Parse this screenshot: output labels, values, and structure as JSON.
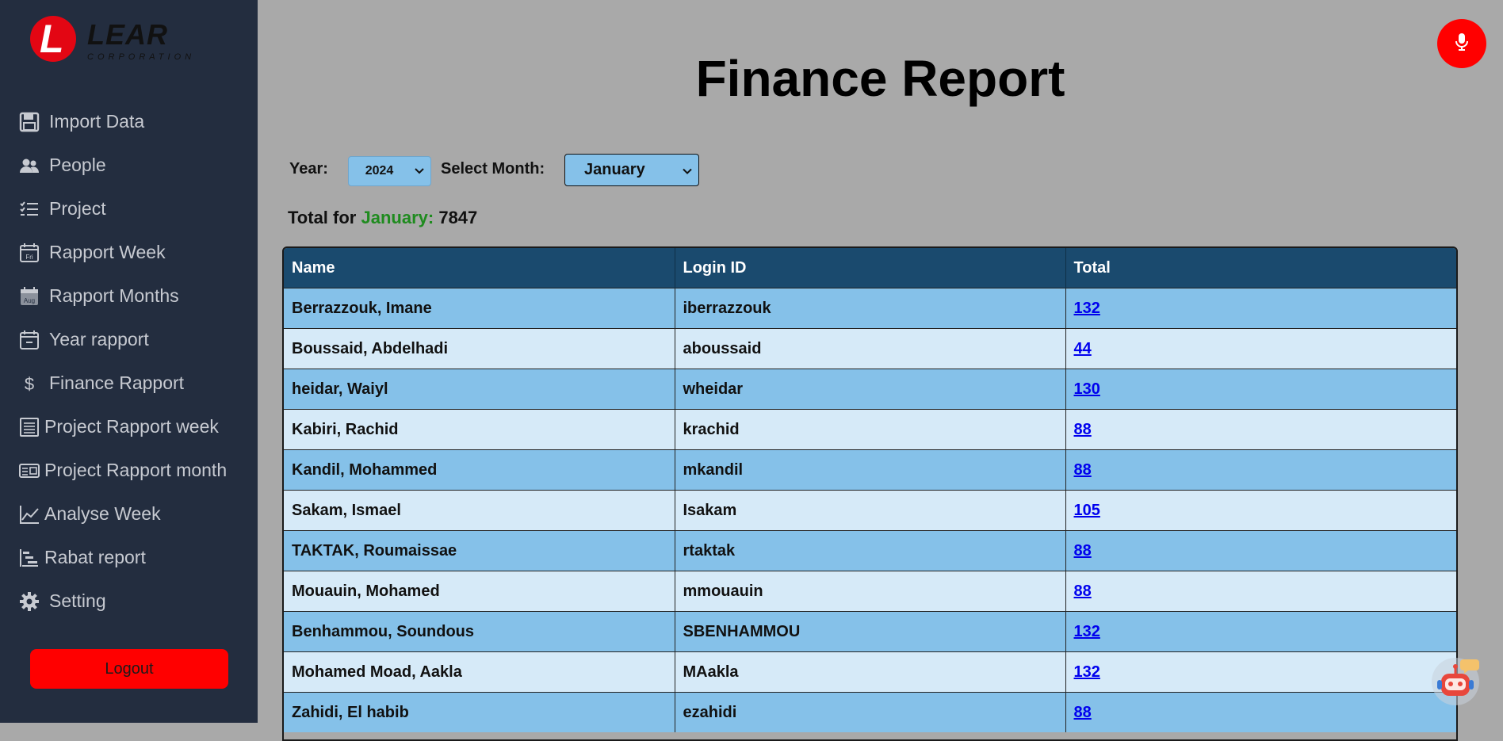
{
  "brand": {
    "name": "LEAR",
    "tagline": "CORPORATION",
    "mark": "L"
  },
  "nav": [
    {
      "label": "Import Data",
      "icon": "save-icon"
    },
    {
      "label": "People",
      "icon": "people-icon"
    },
    {
      "label": "Project",
      "icon": "list-icon"
    },
    {
      "label": "Rapport Week",
      "icon": "calendar-fri-icon"
    },
    {
      "label": "Rapport Months",
      "icon": "calendar-aug-icon"
    },
    {
      "label": "Year rapport",
      "icon": "calendar-minus-icon"
    },
    {
      "label": "Finance Rapport",
      "icon": "dollar-icon"
    },
    {
      "label": "Project Rapport week",
      "icon": "document-icon"
    },
    {
      "label": "Project Rapport month",
      "icon": "card-icon"
    },
    {
      "label": "Analyse Week",
      "icon": "chart-line-icon"
    },
    {
      "label": "Rabat report",
      "icon": "bars-icon"
    },
    {
      "label": "Setting",
      "icon": "gear-icon"
    }
  ],
  "logout_label": "Logout",
  "page_title": "Finance Report",
  "filters": {
    "year_label": "Year:",
    "year_value": "2024",
    "month_label": "Select Month:",
    "month_value": "January"
  },
  "total": {
    "prefix": "Total for",
    "month": "January:",
    "value": "7847"
  },
  "table": {
    "headers": [
      "Name",
      "Login ID",
      "Total"
    ],
    "rows": [
      [
        "Berrazzouk, Imane",
        "iberrazzouk",
        "132"
      ],
      [
        "Boussaid, Abdelhadi",
        "aboussaid",
        "44"
      ],
      [
        "heidar, Waiyl",
        "wheidar",
        "130"
      ],
      [
        "Kabiri, Rachid",
        "krachid",
        "88"
      ],
      [
        "Kandil, Mohammed",
        "mkandil",
        "88"
      ],
      [
        "Sakam, Ismael",
        "Isakam",
        "105"
      ],
      [
        "TAKTAK, Roumaissae",
        "rtaktak",
        "88"
      ],
      [
        "Mouauin, Mohamed",
        "mmouauin",
        "88"
      ],
      [
        "Benhammou, Soundous",
        "SBENHAMMOU",
        "132"
      ],
      [
        "Mohamed Moad, Aakla",
        "MAakla",
        "132"
      ],
      [
        "Zahidi, El habib",
        "ezahidi",
        "88"
      ]
    ]
  },
  "colors": {
    "sidebar": "#232d3f",
    "header": "#1a4a6e",
    "row_dark": "#85c1e9",
    "row_light": "#d6eaf8",
    "accent_red": "#ff0000",
    "month_green": "#1f8b1f"
  }
}
